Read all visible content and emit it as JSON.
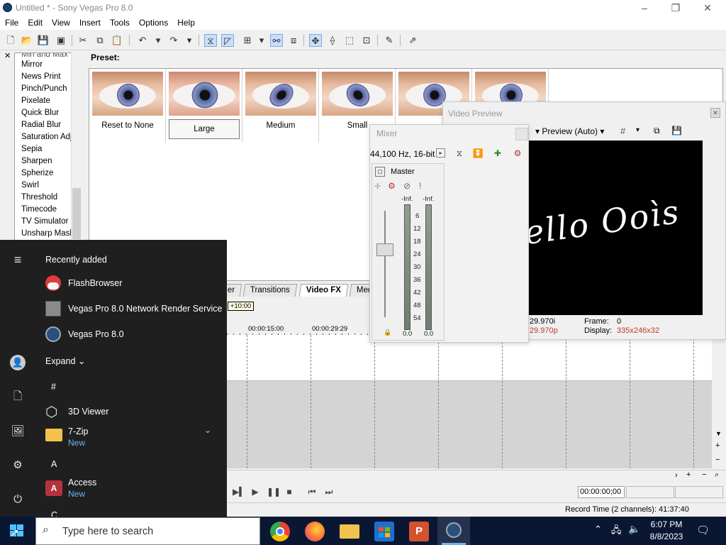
{
  "window": {
    "title": "Untitled * - Sony Vegas Pro 8.0",
    "controls": {
      "minimize": "–",
      "maximize": "❐",
      "close": "✕"
    }
  },
  "menu": [
    "File",
    "Edit",
    "View",
    "Insert",
    "Tools",
    "Options",
    "Help"
  ],
  "fx_list": {
    "top_partial": "Min and Max",
    "items": [
      "Mirror",
      "News Print",
      "Pinch/Punch",
      "Pixelate",
      "Quick Blur",
      "Radial Blur",
      "Saturation Adj",
      "Sepia",
      "Sharpen",
      "Spherize",
      "Swirl",
      "Threshold",
      "Timecode",
      "TV Simulator",
      "Unsharp Mask"
    ]
  },
  "preset_label": "Preset:",
  "presets": [
    "Reset to None",
    "Large",
    "Medium",
    "Small",
    "",
    ""
  ],
  "selected_preset": "Large",
  "tabs": [
    "er",
    "Transitions",
    "Video FX",
    "Med"
  ],
  "active_tab": "Video FX",
  "timeline": {
    "marker": "+10:00",
    "ruler": [
      "00:00:15:00",
      "00:00:29:29"
    ],
    "timecode": "00:00:00;00",
    "record_time": "Record Time (2 channels): 41:37:40"
  },
  "mixer": {
    "title": "Mixer",
    "sample_rate": "44,100 Hz, 16-bit",
    "master_label": "Master",
    "peak_left": "-Inf.",
    "peak_right": "-Inf.",
    "scale": [
      "6",
      "12",
      "18",
      "24",
      "30",
      "36",
      "42",
      "48",
      "54"
    ],
    "level_left": "0.0",
    "level_right": "0.0"
  },
  "video_preview": {
    "title": "Video Preview",
    "quality": "Preview (Auto)",
    "screen_text": "ello Ooìs",
    "fps_project": "29.970i",
    "fps_preview": "29.970p",
    "frame_label": "Frame:",
    "frame_value": "0",
    "display_label": "Display:",
    "display_value": "335x246x32"
  },
  "start_menu": {
    "recently_added_label": "Recently added",
    "recent": [
      "FlashBrowser",
      "Vegas Pro 8.0 Network Render Service",
      "Vegas Pro 8.0"
    ],
    "expand_label": "Expand",
    "sections": [
      "#",
      "A",
      "C"
    ],
    "apps": [
      {
        "name": "3D Viewer",
        "sub": ""
      },
      {
        "name": "7-Zip",
        "sub": "New"
      },
      {
        "name": "Access",
        "sub": "New"
      }
    ]
  },
  "taskbar": {
    "search_placeholder": "Type here to search",
    "time": "6:07 PM",
    "date": "8/8/2023"
  },
  "colors": {
    "accent_red": "#c0392b",
    "start_bg": "#1f1f1f",
    "taskbar_bg": "#0a1733"
  }
}
